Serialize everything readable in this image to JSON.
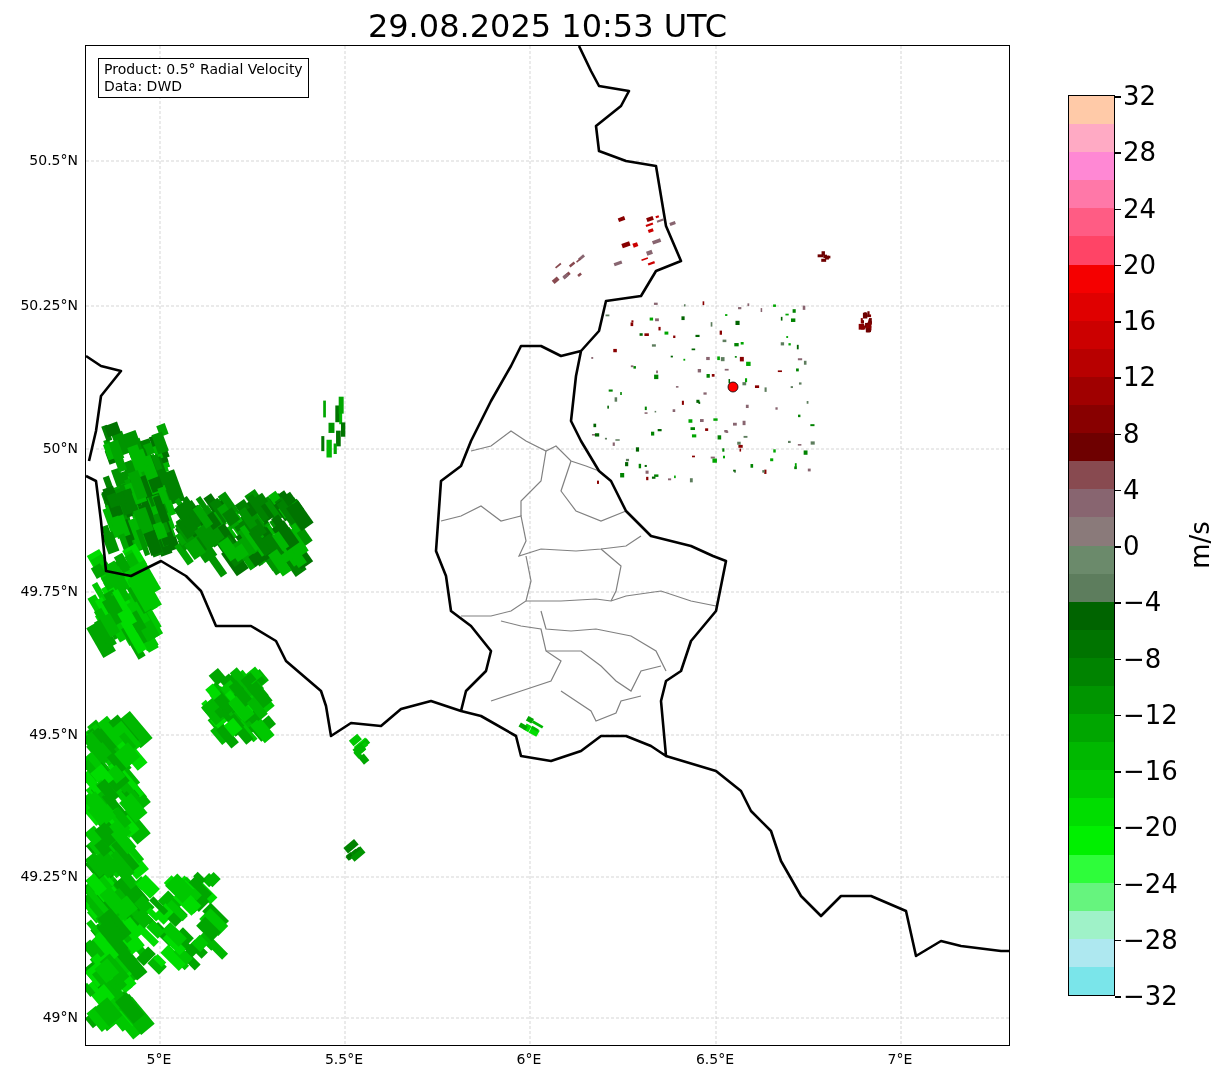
{
  "title": "29.08.2025 10:53 UTC",
  "map": {
    "info_box": [
      "Product: 0.5° Radial Velocity",
      "Data: DWD"
    ],
    "latitude_labels": [
      "50.5°N",
      "50.25°N",
      "50°N",
      "49.75°N",
      "49.5°N",
      "49.25°N",
      "49°N"
    ],
    "longitude_labels": [
      "5°E",
      "5.5°E",
      "6°E",
      "6.5°E",
      "7°E"
    ]
  },
  "colorbar": {
    "label": "m/s",
    "ticks": [
      "32",
      "28",
      "24",
      "20",
      "16",
      "12",
      "8",
      "4",
      "0",
      "−4",
      "−8",
      "−12",
      "−16",
      "−20",
      "−24",
      "−28",
      "−32"
    ],
    "segments": [
      {
        "color": "#ffcaa8"
      },
      {
        "color": "#ffaac4"
      },
      {
        "color": "#ff88d4"
      },
      {
        "color": "#ff78a8"
      },
      {
        "color": "#ff5c84"
      },
      {
        "color": "#ff4466"
      },
      {
        "color": "#f50000"
      },
      {
        "color": "#e00000"
      },
      {
        "color": "#cc0000"
      },
      {
        "color": "#b80000"
      },
      {
        "color": "#a00000"
      },
      {
        "color": "#880000"
      },
      {
        "color": "#6e0000"
      },
      {
        "color": "#884a50"
      },
      {
        "color": "#886570"
      },
      {
        "color": "#8a7a7a"
      },
      {
        "color": "#6b8a6b"
      },
      {
        "color": "#5d7d5d"
      },
      {
        "color": "#006400"
      },
      {
        "color": "#007400"
      },
      {
        "color": "#008300"
      },
      {
        "color": "#009500"
      },
      {
        "color": "#00a600"
      },
      {
        "color": "#00b800"
      },
      {
        "color": "#00c800"
      },
      {
        "color": "#00dd00"
      },
      {
        "color": "#00f000"
      },
      {
        "color": "#2efd3a"
      },
      {
        "color": "#66f47e"
      },
      {
        "color": "#9ff2c8"
      },
      {
        "color": "#aee8f0"
      },
      {
        "color": "#7ae5ea"
      }
    ]
  }
}
